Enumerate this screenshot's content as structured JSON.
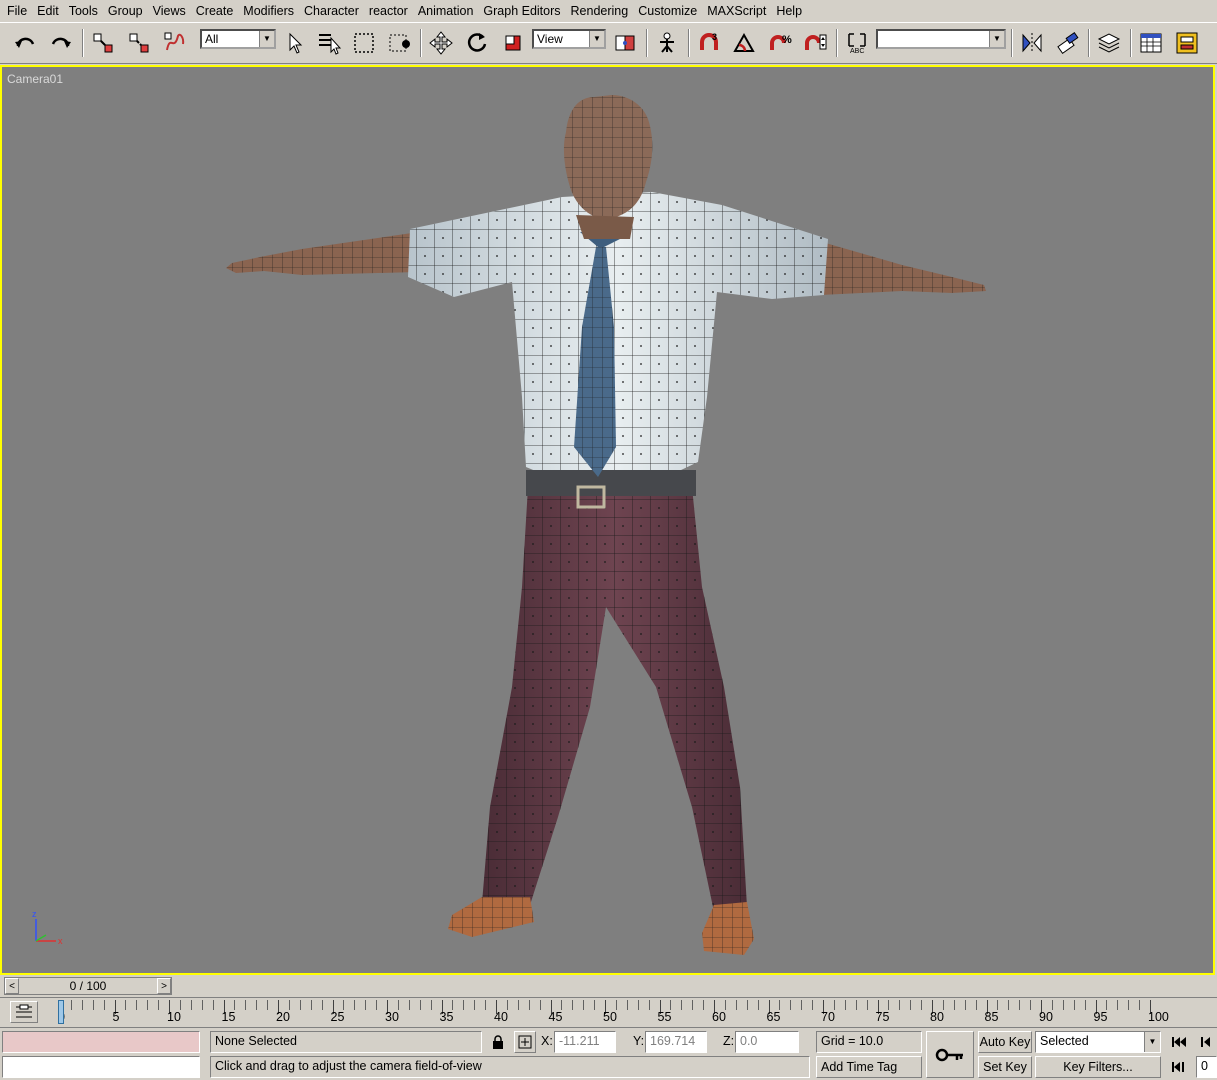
{
  "menu": [
    "File",
    "Edit",
    "Tools",
    "Group",
    "Views",
    "Create",
    "Modifiers",
    "Character",
    "reactor",
    "Animation",
    "Graph Editors",
    "Rendering",
    "Customize",
    "MAXScript",
    "Help"
  ],
  "toolbar": {
    "selection_filter": "All",
    "reference_coord": "View",
    "named_selection": ""
  },
  "viewport": {
    "label": "Camera01",
    "axis": {
      "z": "z",
      "x": "x"
    },
    "border_color": "#ffff00",
    "background": "#7f7f7f"
  },
  "timeline": {
    "slider_label": "0 / 100",
    "ticks": [
      "0",
      "5",
      "10",
      "15",
      "20",
      "25",
      "30",
      "35",
      "40",
      "45",
      "50",
      "55",
      "60",
      "65",
      "70",
      "75",
      "80",
      "85",
      "90",
      "95",
      "100"
    ]
  },
  "status": {
    "selection": "None Selected",
    "prompt": "Click and drag to adjust the camera field-of-view",
    "x_label": "X:",
    "x_value": "-11.211",
    "y_label": "Y:",
    "y_value": "169.714",
    "z_label": "Z:",
    "z_value": "0.0",
    "grid": "Grid = 10.0",
    "add_time_tag": "Add Time Tag",
    "auto_key": "Auto Key",
    "set_key": "Set Key",
    "key_mode": "Selected",
    "key_filters": "Key Filters...",
    "frame": "0"
  }
}
